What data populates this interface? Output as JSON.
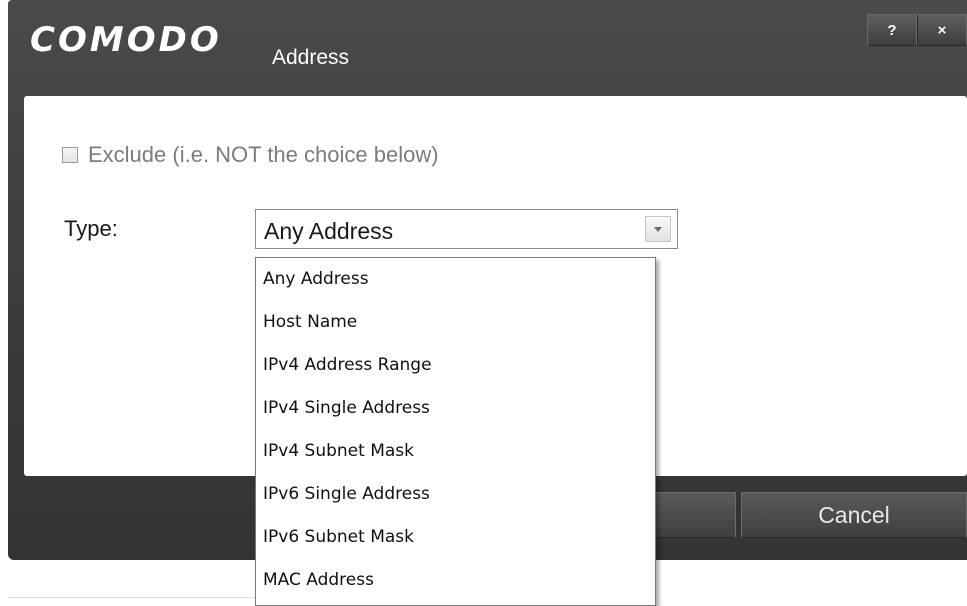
{
  "dialog": {
    "brand": "COMODO",
    "title": "Address",
    "help_label": "?",
    "close_label": "×"
  },
  "form": {
    "exclude_label": "Exclude (i.e. NOT the choice below)",
    "exclude_checked": false,
    "type_label": "Type:",
    "type_selected": "Any Address"
  },
  "dropdown": {
    "options": [
      "Any Address",
      "Host Name",
      "IPv4 Address Range",
      "IPv4 Single Address",
      "IPv4 Subnet Mask",
      "IPv6 Single Address",
      "IPv6 Subnet Mask",
      "MAC Address"
    ]
  },
  "buttons": {
    "ok_label": "",
    "cancel_label": "Cancel"
  },
  "icons": {
    "help": "help-icon",
    "close": "close-icon",
    "dropdown_arrow": "chevron-down-icon"
  }
}
